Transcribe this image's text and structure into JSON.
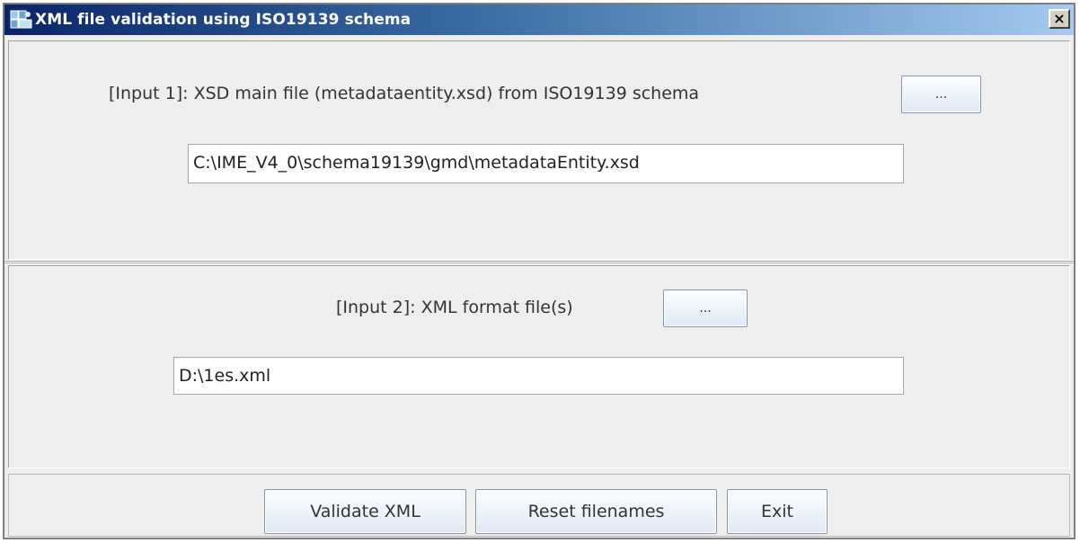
{
  "window": {
    "title": "XML file validation using ISO19139 schema",
    "close_label": "×",
    "icon": "xml-validation-app-icon"
  },
  "input1": {
    "label": "[Input 1]: XSD main file (metadataentity.xsd) from ISO19139 schema",
    "browse_label": "...",
    "path_value": "C:\\IME_V4_0\\schema19139\\gmd\\metadataEntity.xsd"
  },
  "input2": {
    "label": "[Input 2]: XML format file(s)",
    "browse_label": "...",
    "path_value": "D:\\1es.xml"
  },
  "actions": {
    "validate_label": "Validate XML",
    "reset_label": "Reset filenames",
    "exit_label": "Exit"
  },
  "colors": {
    "title_gradient_start": "#0a246a",
    "title_gradient_end": "#a6caf0",
    "window_background": "#eeeeee"
  }
}
